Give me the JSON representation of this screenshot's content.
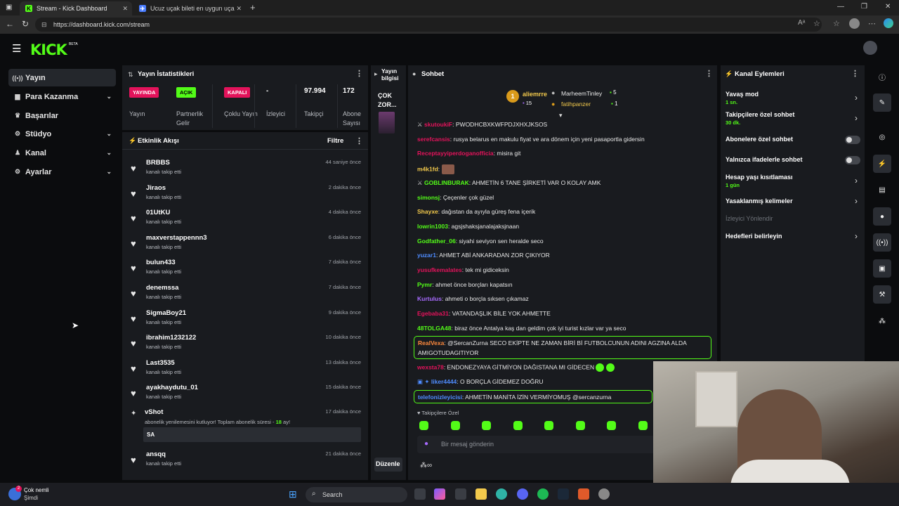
{
  "browser": {
    "tabs": [
      {
        "title": "Stream - Kick Dashboard",
        "active": true
      },
      {
        "title": "Ucuz uçak bileti en uygun uçak b",
        "active": false
      }
    ],
    "new_tab": "+",
    "url": "https://dashboard.kick.com/stream"
  },
  "header": {
    "logo": "KICK",
    "beta": "BETA"
  },
  "sidebar": {
    "items": [
      {
        "label": "Yayın",
        "icon": "broadcast-icon",
        "active": true,
        "expandable": false
      },
      {
        "label": "Para Kazanma",
        "icon": "money-icon",
        "active": false,
        "expandable": true
      },
      {
        "label": "Başarılar",
        "icon": "trophy-icon",
        "active": false,
        "expandable": false
      },
      {
        "label": "Stüdyo",
        "icon": "studio-icon",
        "active": false,
        "expandable": true
      },
      {
        "label": "Kanal",
        "icon": "user-icon",
        "active": false,
        "expandable": true
      },
      {
        "label": "Ayarlar",
        "icon": "gear-icon",
        "active": false,
        "expandable": true
      }
    ]
  },
  "stats": {
    "title": "Yayın İstatistikleri",
    "items": [
      {
        "badge": "YAYINDA",
        "badge_color": "#e3135b",
        "label": "Yayın"
      },
      {
        "badge": "AÇIK",
        "badge_color": "#53fc18",
        "label": "Partnerlik Gelir"
      },
      {
        "badge": "KAPALI",
        "badge_color": "#e3135b",
        "label": "Çoklu Yayın"
      },
      {
        "value": "-",
        "label": "İzleyici"
      },
      {
        "value": "97.994",
        "label": "Takipçi"
      },
      {
        "value": "172",
        "label": "Abone Sayısı"
      }
    ]
  },
  "activity": {
    "title": "Etkinlik Akışı",
    "filter": "Filtre",
    "items": [
      {
        "name": "BRBBS",
        "desc": "kanalı takip etti",
        "time": "44 saniye önce"
      },
      {
        "name": "Jiraos",
        "desc": "kanalı takip etti",
        "time": "2 dakika önce"
      },
      {
        "name": "01UtKU",
        "desc": "kanalı takip etti",
        "time": "4 dakika önce"
      },
      {
        "name": "maxverstappennn3",
        "desc": "kanalı takip etti",
        "time": "6 dakika önce"
      },
      {
        "name": "bulun433",
        "desc": "kanalı takip etti",
        "time": "7 dakika önce"
      },
      {
        "name": "denemssa",
        "desc": "kanalı takip etti",
        "time": "7 dakika önce"
      },
      {
        "name": "SigmaBoy21",
        "desc": "kanalı takip etti",
        "time": "9 dakika önce"
      },
      {
        "name": "ibrahim1232122",
        "desc": "kanalı takip etti",
        "time": "10 dakika önce"
      },
      {
        "name": "Last3535",
        "desc": "kanalı takip etti",
        "time": "13 dakika önce"
      },
      {
        "name": "ayakhaydutu_01",
        "desc": "kanalı takip etti",
        "time": "15 dakika önce"
      }
    ],
    "resub": {
      "name": "vShot",
      "time": "17 dakika önce",
      "text": "abonelik yenilemesini kutluyor! Toplam abonelik süresi - ",
      "months": "18",
      "unit": " ay!",
      "message": "SA"
    },
    "last": {
      "name": "ansqq",
      "desc": "kanalı takip etti",
      "time": "21 dakika önce"
    }
  },
  "stream_info": {
    "title": "Yayın bilgisi",
    "stream_title": "ÇOK ZOR...",
    "edit": "Düzenle"
  },
  "chat": {
    "title": "Sohbet",
    "leaderboard": [
      {
        "rank": "1",
        "name": "aliemrre",
        "count": "15"
      },
      {
        "name": "MarheemTinley",
        "count": "5"
      },
      {
        "name": "fatihpanzer",
        "count": "1"
      }
    ],
    "messages": [
      {
        "user": "skutoukiF",
        "color": "#e3135b",
        "text": "PWODHCBXKWFPDJXHXJKSOS"
      },
      {
        "user": "serefcansis",
        "color": "#e3135b",
        "text": "rusya belarus en makulu fiyat ve ara dönem için yeni pasaportla gidersin"
      },
      {
        "user": "Receptayyiperdoganofficia",
        "color": "#e3135b",
        "text": "misira git"
      },
      {
        "user": "m4k1fd",
        "color": "#f2c94c",
        "text": ""
      },
      {
        "user": "GOBLINBURAK",
        "color": "#53fc18",
        "text": "AHMETİN 6 TANE ŞİRKETİ VAR O KOLAY AMK"
      },
      {
        "user": "simonsj",
        "color": "#53fc18",
        "text": "Çeçenler çok güzel"
      },
      {
        "user": "Shayxe",
        "color": "#f2c94c",
        "text": "dağıstan da ayıyla güreş fena içerik"
      },
      {
        "user": "lowrin1003",
        "color": "#53fc18",
        "text": "agsjshaksjanalajaksjnaan"
      },
      {
        "user": "Godfather_06",
        "color": "#53fc18",
        "text": "siyahi seviyon sen heralde seco"
      },
      {
        "user": "yuzar1",
        "color": "#4f8cff",
        "text": "AHMET ABİ ANKARADAN ZOR ÇIKIYOR"
      },
      {
        "user": "yusufkemalates",
        "color": "#e3135b",
        "text": "tek mi gidiceksin"
      },
      {
        "user": "Pymr",
        "color": "#53fc18",
        "text": "ahmet önce borçları kapatsın"
      },
      {
        "user": "Kurtulus",
        "color": "#a86bff",
        "text": "ahmeti o borçla sıksen çıkamaz"
      },
      {
        "user": "Egebaba31",
        "color": "#e3135b",
        "text": "VATANDAŞLIK BİLE YOK AHMETTE"
      },
      {
        "user": "48TOLGA48",
        "color": "#53fc18",
        "text": "biraz önce Antalya kaş dan geldim çok iyi turist kızlar var ya seco"
      }
    ],
    "highlight1": {
      "user": "RealVexa",
      "color": "#ff8a3d",
      "line1": "@SercanZurna SECO EKİPTE NE ZAMAN BİRİ Bİ FUTBOLCUNUN ADINI AGZINA ALDA",
      "line2": "AMIGOTUDAGITIYOR"
    },
    "msg_after1": {
      "user": "wexsta78",
      "color": "#e3135b",
      "text": "ENDONEZYAYA GİTMİYON DAĞISTANA MI GİDECEN"
    },
    "msg_after2": {
      "user": "liker4444",
      "color": "#4f8cff",
      "text": "O BORÇLA GİDEMEZ DOĞRU"
    },
    "highlight2": {
      "user": "telefonizleyicisi",
      "color": "#4f8cff",
      "text": "AHMETİN MANİTA İZİN VERMİYOMUŞ @sercanzurna"
    },
    "followers_only": "Takipçilere Özel",
    "placeholder": "Bir mesaj gönderin"
  },
  "channel_actions": {
    "title": "Kanal Eylemleri",
    "items": [
      {
        "label": "Yavaş mod",
        "sub": "1 sn.",
        "type": "link"
      },
      {
        "label": "Takipçilere özel sohbet",
        "sub": "30 dk.",
        "type": "link"
      },
      {
        "label": "Abonelere özel sohbet",
        "sub": "",
        "type": "toggle"
      },
      {
        "label": "Yalnızca ifadelerle sohbet",
        "sub": "",
        "type": "toggle"
      },
      {
        "label": "Hesap yaşı kısıtlaması",
        "sub": "1 gün",
        "type": "link"
      },
      {
        "label": "Yasaklanmış kelimeler",
        "sub": "",
        "type": "link"
      },
      {
        "label": "İzleyici Yönlendir",
        "sub": "",
        "type": "disabled"
      },
      {
        "label": "Hedefleri belirleyin",
        "sub": "",
        "type": "link"
      }
    ]
  },
  "taskbar": {
    "notification_title": "Çok nemli",
    "notification_sub": "Şimdi",
    "notification_badge": "2",
    "search": "Search"
  },
  "colors": {
    "accent": "#53fc18",
    "live": "#e3135b",
    "panel": "#191b1f",
    "bg": "#0b0c0e"
  }
}
